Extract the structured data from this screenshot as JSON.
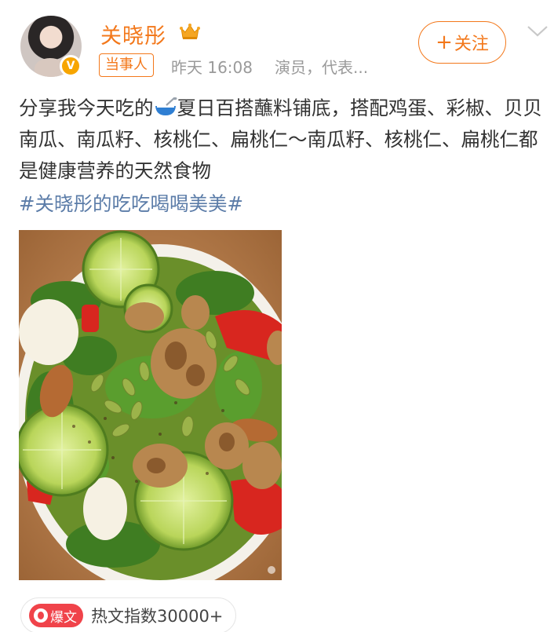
{
  "header": {
    "username": "关晓彤",
    "tag": "当事人",
    "time": "昨天 16:08",
    "description": "演员，代表...",
    "follow_label": "关注",
    "follow_plus": "+"
  },
  "post": {
    "text_before_emoji": "分享我今天吃的",
    "text_after_emoji": "夏日百搭蘸料铺底，搭配鸡蛋、彩椒、贝贝南瓜、南瓜籽、核桃仁、扁桃仁～南瓜籽、核桃仁、扁桃仁都是健康营养的天然食物",
    "hashtag": "#关晓彤的吃吃喝喝美美#",
    "emoji_icon": "salad-bowl-icon",
    "image_subject": "salad-photo"
  },
  "footer": {
    "hot_badge": "爆文",
    "hot_label": "热文指数30000+"
  },
  "colors": {
    "brand_orange": "#f3781b",
    "link_blue": "#5b7ca8",
    "meta_gray": "#9a9a9a",
    "hot_red": "#f0434a"
  }
}
